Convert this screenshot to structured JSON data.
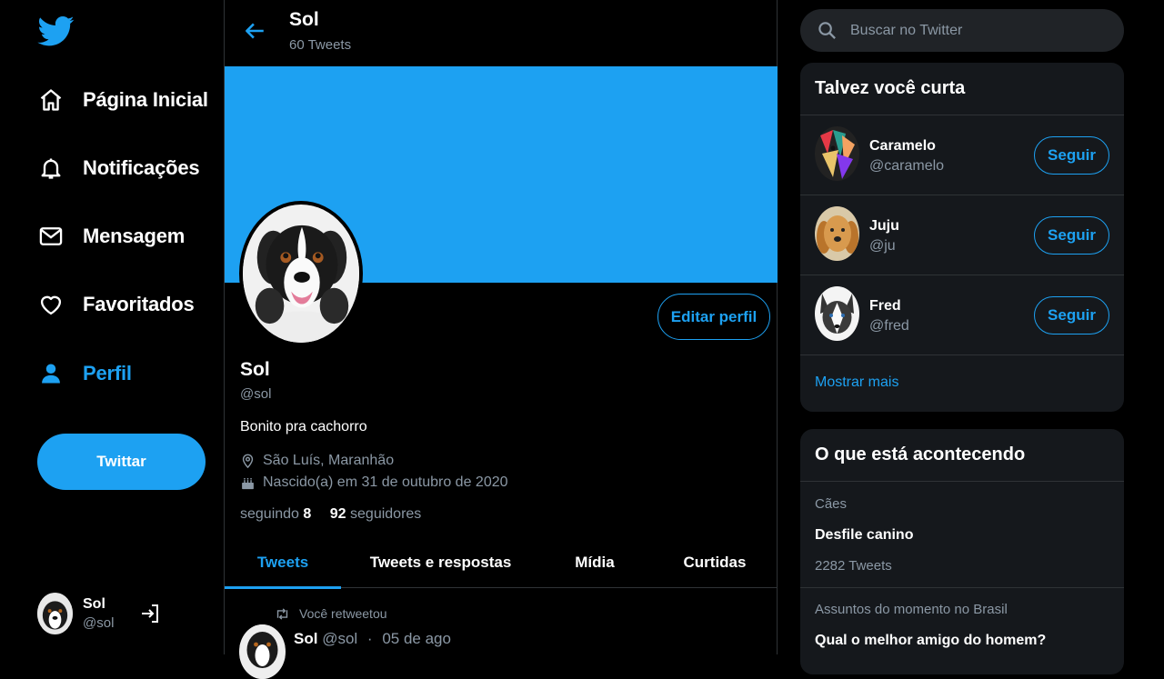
{
  "nav": {
    "items": [
      {
        "label": "Página Inicial",
        "icon": "home-icon"
      },
      {
        "label": "Notificações",
        "icon": "bell-icon"
      },
      {
        "label": "Mensagem",
        "icon": "mail-icon"
      },
      {
        "label": "Favoritados",
        "icon": "heart-icon"
      },
      {
        "label": "Perfil",
        "icon": "person-icon",
        "active": true
      }
    ],
    "tweet_button": "Twittar",
    "account": {
      "name": "Sol",
      "handle": "@sol"
    }
  },
  "header": {
    "name": "Sol",
    "tweet_count": "60 Tweets"
  },
  "profile": {
    "name": "Sol",
    "handle": "@sol",
    "bio": "Bonito pra cachorro",
    "location": "São Luís, Maranhão",
    "birthday": "Nascido(a) em 31 de outubro de 2020",
    "following_label": "seguindo",
    "following_count": "8",
    "followers_count": "92",
    "followers_label": "seguidores",
    "edit_button": "Editar perfil"
  },
  "tabs": [
    "Tweets",
    "Tweets e respostas",
    "Mídia",
    "Curtidas"
  ],
  "tweet": {
    "retweet_label": "Você retweetou",
    "author": "Sol",
    "handle": "@sol",
    "separator": "·",
    "date": "05 de ago"
  },
  "search": {
    "placeholder": "Buscar no Twitter"
  },
  "suggestions": {
    "title": "Talvez você curta",
    "users": [
      {
        "name": "Caramelo",
        "handle": "@caramelo",
        "button": "Seguir"
      },
      {
        "name": "Juju",
        "handle": "@ju",
        "button": "Seguir"
      },
      {
        "name": "Fred",
        "handle": "@fred",
        "button": "Seguir"
      }
    ],
    "show_more": "Mostrar mais"
  },
  "trends": {
    "title": "O que está acontecendo",
    "items": [
      {
        "category": "Cães",
        "title": "Desfile canino",
        "count": "2282 Tweets"
      },
      {
        "category": "Assuntos do momento no Brasil",
        "title": "Qual o melhor amigo do homem?"
      }
    ]
  },
  "colors": {
    "accent": "#1da1f2",
    "background": "#000000",
    "card": "#15181c",
    "muted": "#8b98a5"
  }
}
